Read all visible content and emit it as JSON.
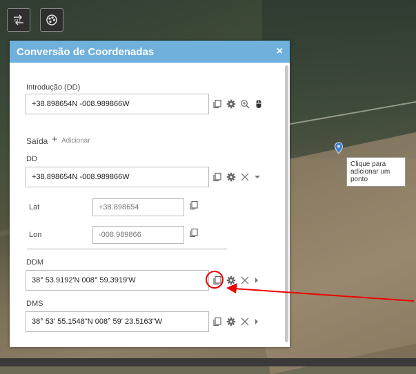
{
  "panel": {
    "title": "Conversão de Coordenadas",
    "close": "×",
    "input_label": "Introdução (DD)",
    "input_value": "+38.898654N -008.989866W",
    "output_label": "Saída",
    "add_plus": "+",
    "add_label": "Adicionar",
    "outputs": {
      "dd": {
        "label": "DD",
        "value": "+38.898654N -008.989866W"
      },
      "lat": {
        "label": "Lat",
        "value": "+38.898654"
      },
      "lon": {
        "label": "Lon",
        "value": "-008.989866"
      },
      "ddm": {
        "label": "DDM",
        "value": "38° 53.9192'N 008° 59.3919'W"
      },
      "dms": {
        "label": "DMS",
        "value": "38° 53' 55.1548\"N 008° 59' 23.5163\"W"
      }
    }
  },
  "map": {
    "tooltip": "Clique para adicionar um ponto",
    "toolbar": {
      "xyz_icon": "xyz-icon",
      "palette_icon": "palette-icon"
    }
  },
  "colors": {
    "header": "#6fb0dd",
    "annotation": "#e00000"
  }
}
